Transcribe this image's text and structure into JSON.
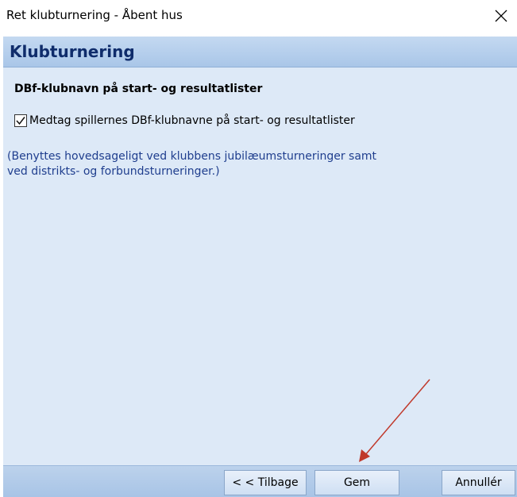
{
  "window": {
    "title": "Ret klubturnering - Åbent hus",
    "close_icon": "close-icon"
  },
  "header": {
    "title": "Klubturnering"
  },
  "main": {
    "subheading": "DBf-klubnavn på start- og resultatlister",
    "checkbox": {
      "label": "Medtag spillernes DBf-klubnavne på start- og resultatlister",
      "checked": true
    },
    "note_line1": "(Benyttes hovedsageligt ved klubbens jubilæumsturneringer samt",
    "note_line2": "ved distrikts- og forbundsturneringer.)"
  },
  "footer": {
    "back_label": "< < Tilbage",
    "save_label": "Gem",
    "cancel_label": "Annullér"
  },
  "colors": {
    "header_bg": "#b5cdec",
    "header_text": "#0f2c6b",
    "content_bg": "#dde9f7",
    "note_text": "#1f3e8e",
    "annotation_arrow": "#c0392b"
  }
}
